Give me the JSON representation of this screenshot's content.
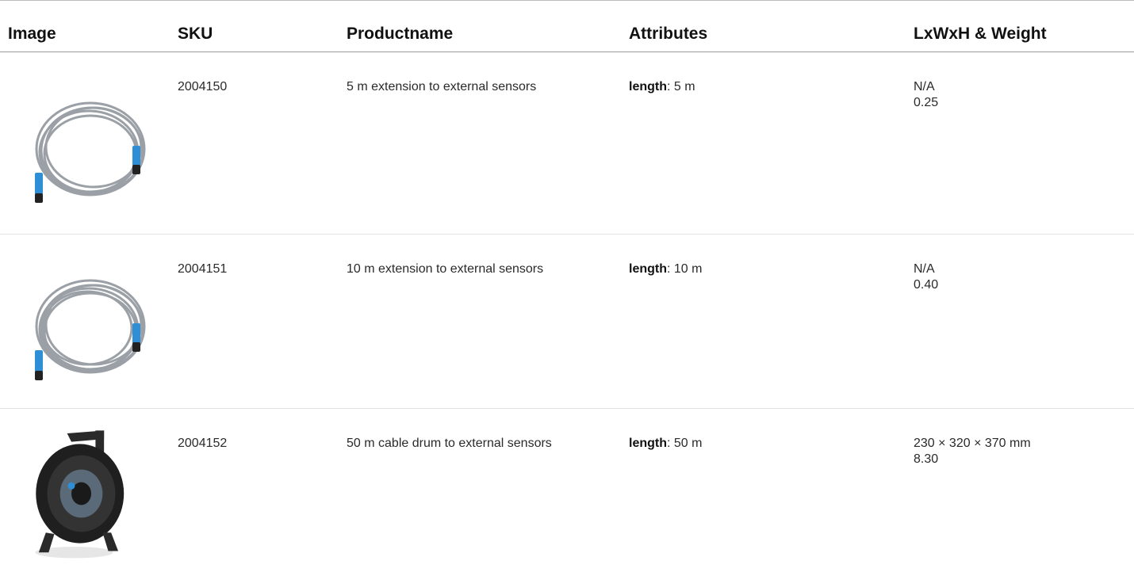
{
  "headers": {
    "image": "Image",
    "sku": "SKU",
    "productname": "Productname",
    "attributes": "Attributes",
    "dims": "LxWxH & Weight"
  },
  "rows": [
    {
      "sku": "2004150",
      "name": "5 m extension to external sensors",
      "attr_key": "length",
      "attr_val": ": 5 m",
      "dims": "N/A",
      "weight": "0.25",
      "image": "coiled-cable"
    },
    {
      "sku": "2004151",
      "name": "10 m extension to external sensors",
      "attr_key": "length",
      "attr_val": ": 10 m",
      "dims": "N/A",
      "weight": "0.40",
      "image": "coiled-cable"
    },
    {
      "sku": "2004152",
      "name": "50 m cable drum to external sensors",
      "attr_key": "length",
      "attr_val": ": 50 m",
      "dims": "230 × 320 × 370 mm",
      "weight": "8.30",
      "image": "cable-drum"
    }
  ],
  "colors": {
    "cable": "#9aa0a6",
    "connector": "#2f8fd6",
    "drum": "#1f1f1f"
  }
}
